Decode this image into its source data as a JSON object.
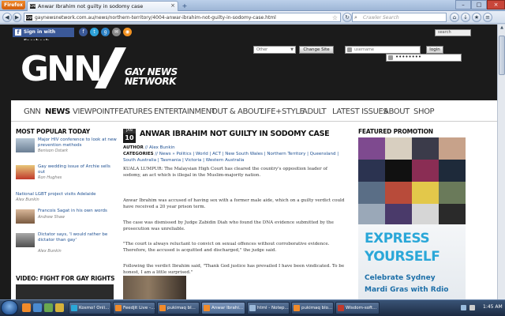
{
  "browser": {
    "app_button": "Firefox",
    "tab_title": "Anwar Ibrahim not guilty in sodomy case",
    "url": "gaynewsnetwork.com.au/news/northern-territory/4004-anwar-ibrahim-not-guilty-in-sodomy-case.html",
    "search_placeholder": "Crawler Search"
  },
  "site": {
    "signin_facebook": "Sign in with Facebook",
    "search_placeholder": "search",
    "logo": "GNN",
    "logo_tagline_1": "GAY NEWS",
    "logo_tagline_2": "NETWORK",
    "city_select": "Other",
    "change_site": "Change Site",
    "username_placeholder": "username",
    "password_mask": "••••••••",
    "login": "login"
  },
  "nav": [
    "GNN",
    "NEWS",
    "VIEWPOINT",
    "FEATURES",
    "ENTERTAINMENT",
    "OUT & ABOUT",
    "LIFE+STYLE",
    "ADULT",
    "LATEST ISSUES",
    "ABOUT",
    "SHOP"
  ],
  "most_popular": {
    "heading": "MOST POPULAR TODAY",
    "items": [
      {
        "title": "Major HIV conference to look at new prevention methods",
        "author": "Benison Ostark"
      },
      {
        "title": "Gay wedding issue of Archie sells out",
        "author": "Ron Hughes"
      },
      {
        "title": "National LGBT project visits Adelaide",
        "author": "Alex Bunkin"
      },
      {
        "title": "Francois Sagat in his own words",
        "author": "Andrew Shaw"
      },
      {
        "title": "Dictator says, 'I would rather be dictator than gay'",
        "author": "Alex Bunkin"
      }
    ]
  },
  "video_heading": "VIDEO: FIGHT FOR GAY RIGHTS",
  "article": {
    "date_month": "JAN",
    "date_day": "10",
    "title": "ANWAR IBRAHIM NOT GUILTY IN SODOMY CASE",
    "author_label": "AUTHOR",
    "author": "// Alex Bunkin",
    "categories_label": "CATEGORIES",
    "categories": "// News » Politics | World | ACT | New South Wales | Northern Territory | Queensland | South Australia | Tasmania | Victoria | Western Australia",
    "paragraphs": [
      "KUALA LUMPUR: The Malaysian High Court has cleared the country's opposition leader of sodomy, an act which is illegal in the Muslim-majority nation.",
      "Anwar Ibrahim was accused of having sex with a former male aide, which on a guilty verdict could have received a 20 year prison term.",
      "The case was dismissed by Judge Zabidin Diah who found the DNA evidence submitted by the prosecution was unreliable.",
      "\"The court is always reluctant to convict on sexual offences without corroborative evidence. Therefore, the accused is acquitted and discharged,\" the judge said.",
      "Following the verdict Ibrahim said, \"Thank God justice has prevailed I have been vindicated. To be honest, I am a little surprised.\""
    ]
  },
  "featured": {
    "heading": "FEATURED PROMOTION",
    "ad_line1": "EXPRESS",
    "ad_line2": "YOURSELF",
    "ad_line3": "Celebrate Sydney",
    "ad_line4": "Mardi Gras with Rdio"
  },
  "taskbar": {
    "items": [
      "Kosmo! Onli...",
      "Feedjit Live -...",
      "pukimaq bl...",
      "Anwar Ibrahi...",
      "html - Notep...",
      "pukimaq blo...",
      "Wisdom-soft..."
    ],
    "clock": "1:45 AM"
  },
  "colors": {
    "link": "#1d4f91",
    "ad_accent": "#2aa7d8",
    "header_bg": "#1b1b1b"
  }
}
